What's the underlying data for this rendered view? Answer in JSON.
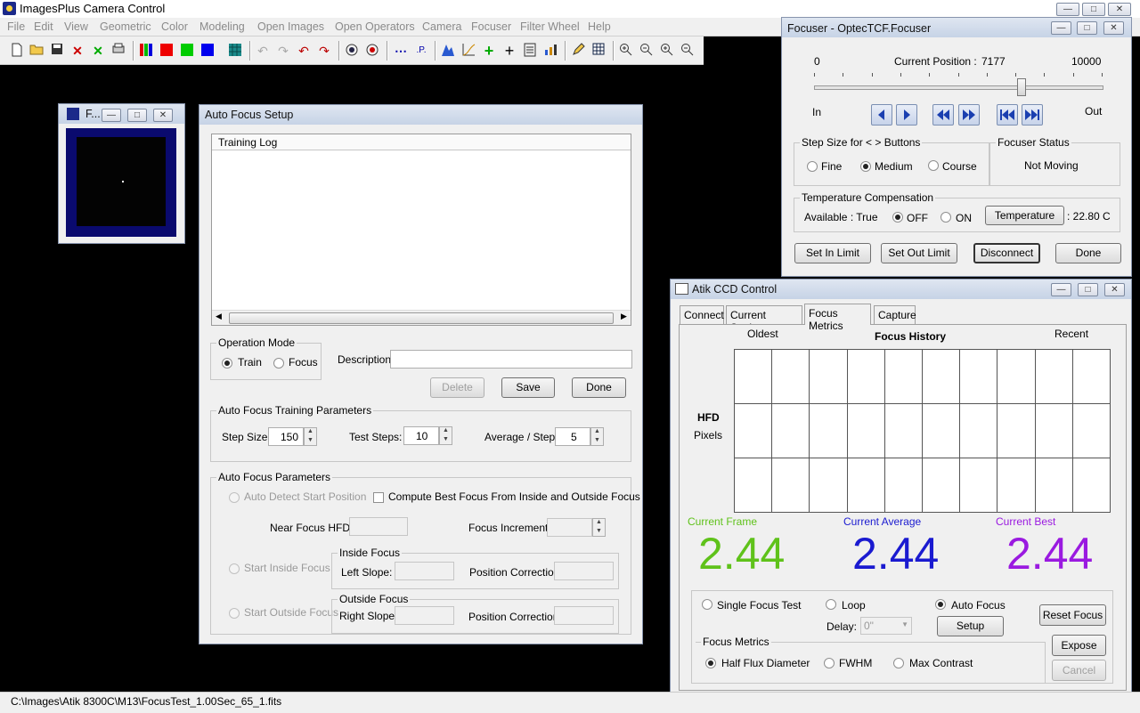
{
  "app": {
    "title": "ImagesPlus Camera Control"
  },
  "menu": [
    "File",
    "Edit",
    "View",
    "Geometric",
    "Color",
    "Modeling",
    "Open Images",
    "Open Operators",
    "Camera",
    "Focuser",
    "Filter Wheel",
    "Help"
  ],
  "status": {
    "path": "C:\\Images\\Atik 8300C\\M13\\FocusTest_1.00Sec_65_1.fits"
  },
  "thumb": {
    "title": "F..."
  },
  "autofocus": {
    "title": "Auto Focus Setup",
    "log_header": "Training Log",
    "op_mode_label": "Operation Mode",
    "train_label": "Train",
    "focus_label": "Focus",
    "description_label": "Description:",
    "delete_label": "Delete",
    "save_label": "Save",
    "done_label": "Done",
    "training_params_label": "Auto Focus Training Parameters",
    "step_size_label": "Step Size:",
    "step_size_value": "150",
    "test_steps_label": "Test Steps:",
    "test_steps_value": "10",
    "avg_step_label": "Average / Step:",
    "avg_step_value": "5",
    "params_label": "Auto Focus Parameters",
    "auto_detect_label": "Auto Detect Start Position",
    "compute_best_label": "Compute Best Focus From Inside and Outside Focus",
    "near_hfd_label": "Near Focus HFD:",
    "focus_increment_label": "Focus Increment:",
    "inside_focus_label": "Inside Focus",
    "start_inside_label": "Start Inside Focus",
    "left_slope_label": "Left Slope:",
    "position_correction_label": "Position Correction:",
    "outside_focus_label": "Outside Focus",
    "start_outside_label": "Start Outside Focus",
    "right_slope_label": "Right Slope:"
  },
  "focuser": {
    "title": "Focuser - OptecTCF.Focuser",
    "min": "0",
    "max": "10000",
    "current_label": "Current Position :",
    "current_value": "7177",
    "slider_fraction": 0.7177,
    "in_label": "In",
    "out_label": "Out",
    "step_size_label": "Step Size for < > Buttons",
    "fine_label": "Fine",
    "medium_label": "Medium",
    "course_label": "Course",
    "status_label": "Focuser Status",
    "status_value": "Not Moving",
    "temp_comp_label": "Temperature Compensation",
    "available_text": "Available : True",
    "off_label": "OFF",
    "on_label": "ON",
    "temperature_button": "Temperature",
    "temperature_value": ": 22.80 C",
    "set_in_limit": "Set In Limit",
    "set_out_limit": "Set Out Limit",
    "disconnect": "Disconnect",
    "done": "Done"
  },
  "ccd": {
    "title": "Atik CCD Control",
    "tabs": [
      "Connect",
      "Current Settings",
      "Focus Metrics",
      "Capture"
    ],
    "oldest_label": "Oldest",
    "focus_history_label": "Focus History",
    "recent_label": "Recent",
    "hfd_label": "HFD",
    "pixels_label": "Pixels",
    "current_frame_label": "Current Frame",
    "current_frame_value": "2.44",
    "current_average_label": "Current Average",
    "current_average_value": "2.44",
    "current_best_label": "Current Best",
    "current_best_value": "2.44",
    "single_focus_label": "Single Focus Test",
    "loop_label": "Loop",
    "auto_focus_label": "Auto Focus",
    "reset_focus_label": "Reset Focus",
    "delay_label": "Delay:",
    "delay_value": "0\"",
    "setup_label": "Setup",
    "focus_metrics_group": "Focus Metrics",
    "hfd_metric_label": "Half Flux Diameter",
    "fwhm_label": "FWHM",
    "max_contrast_label": "Max Contrast",
    "expose_label": "Expose",
    "cancel_label": "Cancel",
    "colors": {
      "frame": "#5fc21a",
      "average": "#1a1ad0",
      "best": "#9a1ae0"
    }
  }
}
